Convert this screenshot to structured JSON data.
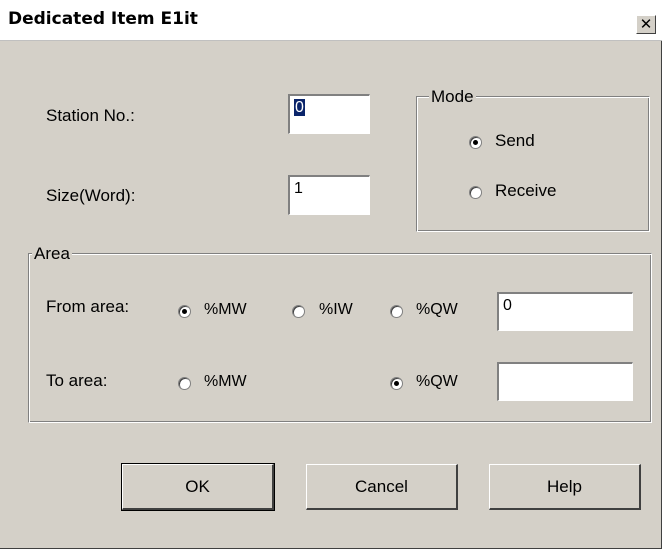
{
  "window": {
    "title": "Dedicated Item E1it",
    "close_glyph": "✕"
  },
  "station": {
    "label": "Station No.:",
    "value": "0"
  },
  "size": {
    "label": "Size(Word):",
    "value": "1"
  },
  "mode": {
    "legend": "Mode",
    "send_label": "Send",
    "receive_label": "Receive",
    "selected": "Send"
  },
  "area": {
    "legend": "Area",
    "from_label": "From area:",
    "to_label": "To area:",
    "from_options": {
      "mw": "%MW",
      "iw": "%IW",
      "qw": "%QW",
      "selected": "%MW"
    },
    "to_options": {
      "mw": "%MW",
      "qw": "%QW",
      "selected": "%QW"
    },
    "from_value": "0",
    "to_value": ""
  },
  "buttons": {
    "ok": "OK",
    "cancel": "Cancel",
    "help": "Help"
  }
}
